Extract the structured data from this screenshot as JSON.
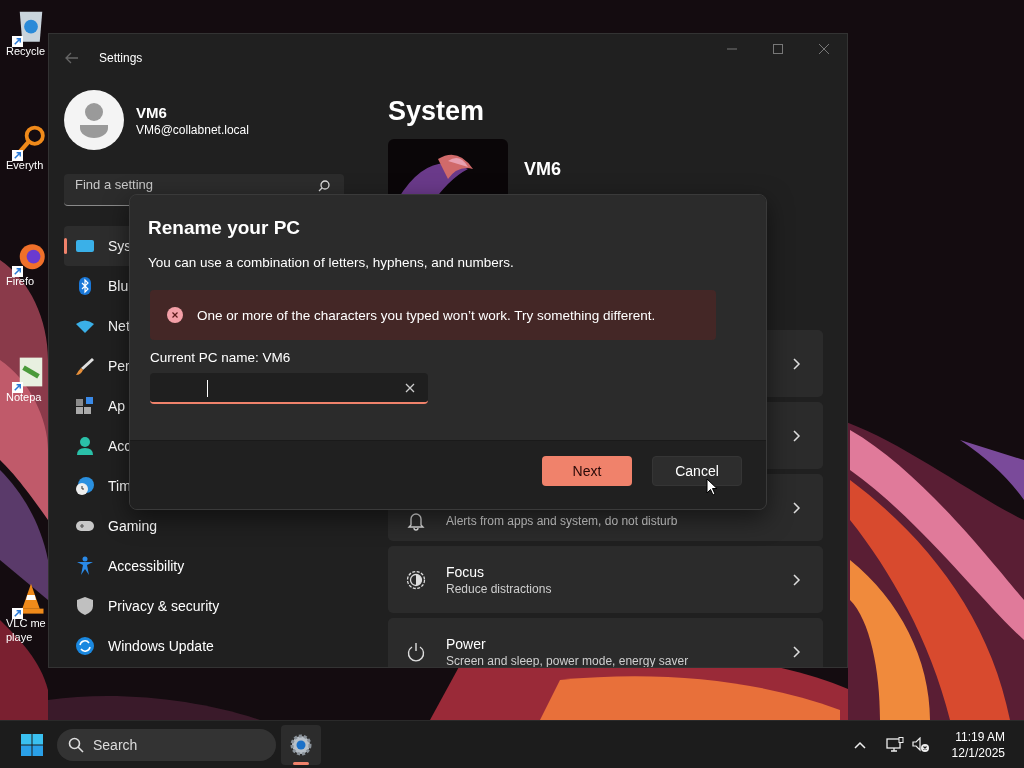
{
  "desktop": {
    "icons": [
      {
        "lines": [
          "Recycle"
        ]
      },
      {
        "lines": [
          "Everyth"
        ]
      },
      {
        "lines": [
          "Firefo"
        ]
      },
      {
        "lines": [
          "Notepa"
        ]
      },
      {
        "lines": [
          "VLC me",
          "playe"
        ]
      }
    ]
  },
  "window": {
    "title": "Settings",
    "user": {
      "name": "VM6",
      "email": "VM6@collabnet.local"
    },
    "search": {
      "placeholder": "Find a setting"
    },
    "nav": [
      {
        "label": "Sys",
        "selected": true
      },
      {
        "label": "Blu",
        "selected": false
      },
      {
        "label": "Net",
        "selected": false
      },
      {
        "label": "Per",
        "selected": false
      },
      {
        "label": "Ap",
        "selected": false
      },
      {
        "label": "Acc",
        "selected": false
      },
      {
        "label": "Tim",
        "selected": false
      },
      {
        "label": "Gaming",
        "selected": false
      },
      {
        "label": "Accessibility",
        "selected": false
      },
      {
        "label": "Privacy & security",
        "selected": false
      },
      {
        "label": "Windows Update",
        "selected": false
      }
    ],
    "page_title": "System",
    "device_name": "VM6",
    "cards": [
      {
        "kind": "link"
      },
      {
        "kind": "link"
      },
      {
        "kind": "link",
        "subtitle": "Alerts from apps and system, do not disturb"
      },
      {
        "kind": "link",
        "title": "Focus",
        "subtitle": "Reduce distractions"
      },
      {
        "kind": "link",
        "title": "Power",
        "subtitle": "Screen and sleep, power mode, energy saver"
      }
    ]
  },
  "dialog": {
    "title": "Rename your PC",
    "description": "You can use a combination of letters, hyphens, and numbers.",
    "error": "One or more of the characters you typed won’t work. Try something different.",
    "field": {
      "label": "Current PC name: VM6",
      "invalid": true
    },
    "buttons": [
      {
        "label": "Next",
        "kind": "primary"
      },
      {
        "label": "Cancel",
        "kind": "secondary"
      }
    ]
  },
  "taskbar": {
    "search": {
      "placeholder": "Search"
    },
    "apps": [
      {
        "active": true
      }
    ],
    "time": "11:19 AM",
    "date": "12/1/2025"
  }
}
